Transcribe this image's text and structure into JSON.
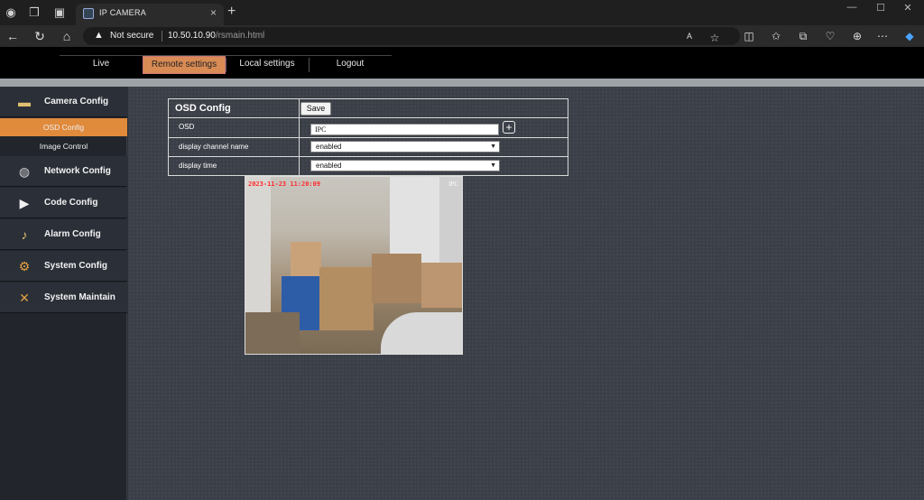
{
  "browser": {
    "tab_title": "IP CAMERA",
    "security_label": "Not secure",
    "url_host": "10.50.10.90",
    "url_path": "/rsmain.html"
  },
  "menu": {
    "items": [
      {
        "label": "Live"
      },
      {
        "label": "Remote settings"
      },
      {
        "label": "Local settings"
      },
      {
        "label": "Logout"
      }
    ],
    "active": "Remote settings"
  },
  "sidebar": {
    "camera_config": "Camera Config",
    "osd_config": "OSD Config",
    "image_control": "Image Control",
    "network_config": "Network Config",
    "code_config": "Code Config",
    "alarm_config": "Alarm Config",
    "system_config": "System Config",
    "system_maintain": "System Maintain"
  },
  "osd": {
    "title": "OSD Config",
    "save_label": "Save",
    "osd_label": "OSD",
    "osd_value": "IPC",
    "channel_label": "display channel name",
    "channel_value": "enabled",
    "time_label": "display time",
    "time_value": "enabled"
  },
  "preview": {
    "timestamp": "2023-11-23 11:20:09",
    "channel_name": "IPC"
  },
  "colors": {
    "accent": "#e08a3c",
    "menu_active": "#d98b55",
    "osd_text": "#ff2a2a"
  }
}
